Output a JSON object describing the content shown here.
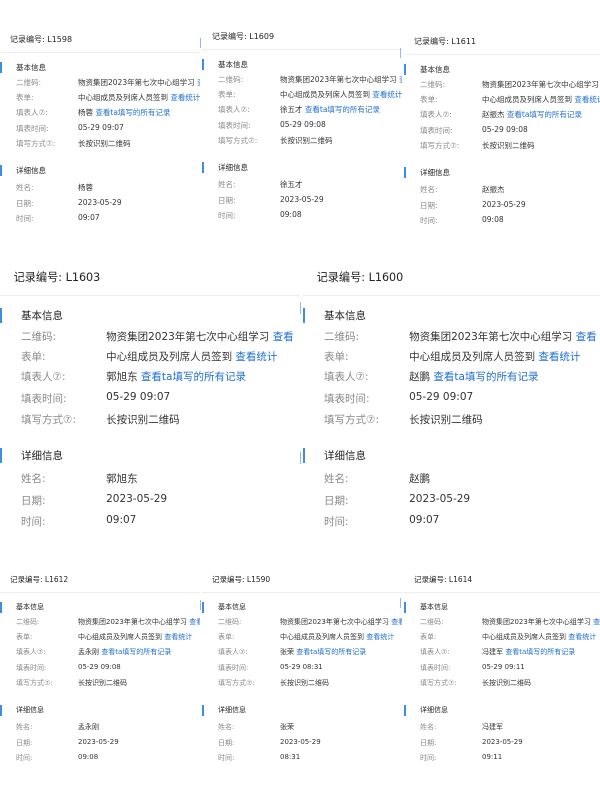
{
  "labels": {
    "record_no": "记录编号: ",
    "basic_info": "基本信息",
    "detail_info": "详细信息",
    "qrcode": "二维码:",
    "form": "表单:",
    "filler": "填表人⑦:",
    "fill_time": "填表时间:",
    "fill_method": "填写方式⑦:",
    "name": "姓名:",
    "date": "日期:",
    "time": "时间:"
  },
  "links": {
    "view": "查看",
    "view_stats": "查看统计",
    "view_all_records": "查看ta填写的所有记录"
  },
  "records": [
    {
      "id": "L1598",
      "qrcode": "物资集团2023年第七次中心组学习",
      "form": "中心组成员及列席人员签到",
      "filler": "杨蓉",
      "fill_time": "05-29 09:07",
      "fill_method": "长按识别二维码",
      "name": "杨蓉",
      "date": "2023-05-29",
      "time": "09:07"
    },
    {
      "id": "L1609",
      "qrcode": "物资集团2023年第七次中心组学习",
      "form": "中心组成员及列席人员签到",
      "filler": "徐五才",
      "fill_time": "05-29 09:08",
      "fill_method": "长按识别二维码",
      "name": "徐五才",
      "date": "2023-05-29",
      "time": "09:08"
    },
    {
      "id": "L1611",
      "qrcode": "物资集团2023年第七次中心组学习",
      "form": "中心组成员及列席人员签到",
      "filler": "赵振杰",
      "fill_time": "05-29 09:08",
      "fill_method": "长按识别二维码",
      "name": "赵振杰",
      "date": "2023-05-29",
      "time": "09:08"
    },
    {
      "id": "L1603",
      "qrcode": "物资集团2023年第七次中心组学习",
      "form": "中心组成员及列席人员签到",
      "filler": "郭旭东",
      "fill_time": "05-29 09:07",
      "fill_method": "长按识别二维码",
      "name": "郭旭东",
      "date": "2023-05-29",
      "time": "09:07"
    },
    {
      "id": "L1600",
      "qrcode": "物资集团2023年第七次中心组学习",
      "form": "中心组成员及列席人员签到",
      "filler": "赵鹏",
      "fill_time": "05-29 09:07",
      "fill_method": "长按识别二维码",
      "name": "赵鹏",
      "date": "2023-05-29",
      "time": "09:07"
    },
    {
      "id": "L1612",
      "qrcode": "物资集团2023年第七次中心组学习",
      "form": "中心组成员及列席人员签到",
      "filler": "孟永刚",
      "fill_time": "05-29 09:08",
      "fill_method": "长按识别二维码",
      "name": "孟永刚",
      "date": "2023-05-29",
      "time": "09:08"
    },
    {
      "id": "L1590",
      "qrcode": "物资集团2023年第七次中心组学习",
      "form": "中心组成员及列席人员签到",
      "filler": "张荣",
      "fill_time": "05-29 08:31",
      "fill_method": "长按识别二维码",
      "name": "张荣",
      "date": "2023-05-29",
      "time": "08:31"
    },
    {
      "id": "L1614",
      "qrcode": "物资集团2023年第七次中心组学习",
      "form": "中心组成员及列席人员签到",
      "filler": "冯建军",
      "fill_time": "05-29 09:11",
      "fill_method": "长按识别二维码",
      "name": "冯建军",
      "date": "2023-05-29",
      "time": "09:11"
    }
  ]
}
